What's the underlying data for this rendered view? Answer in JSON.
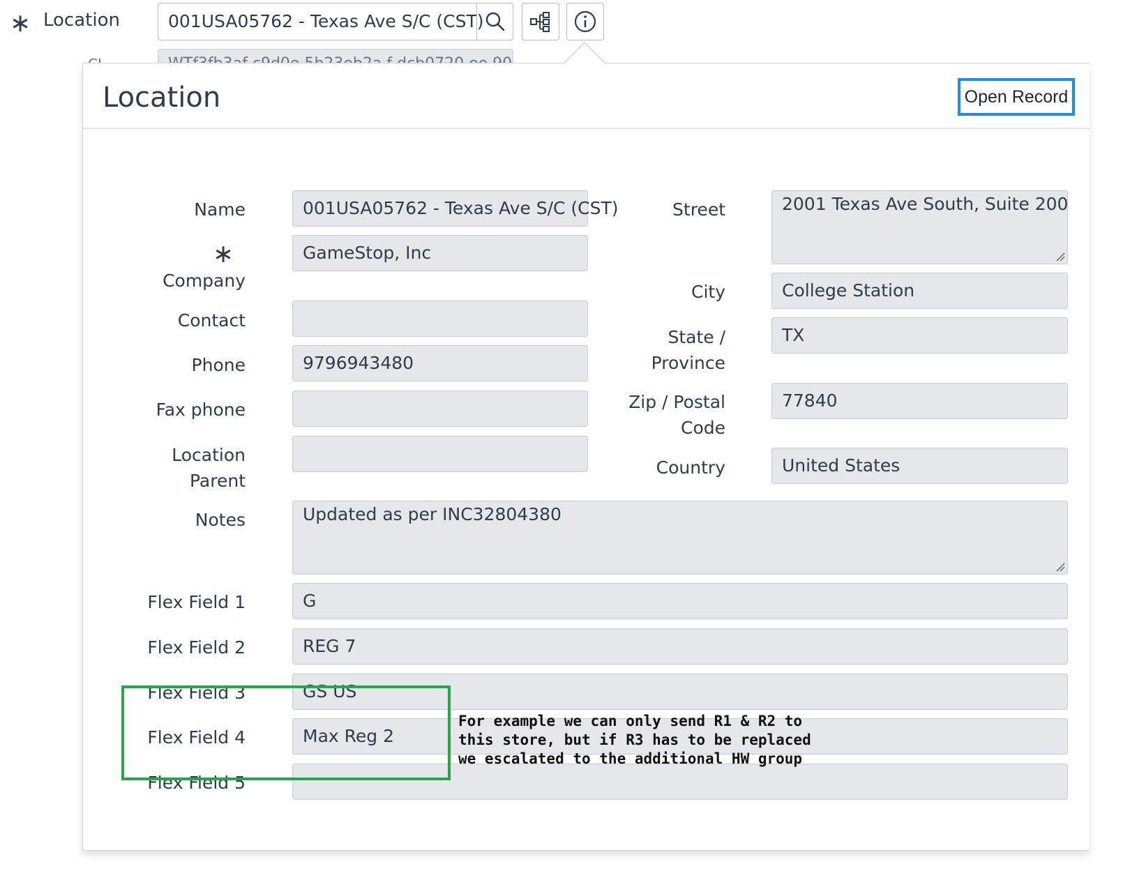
{
  "top_form": {
    "location_label": "Location",
    "location_value": "001USA05762 - Texas Ave S/C (CST)",
    "behind_label": "CI",
    "behind_value": "WTf3fb3af c9d0e 5b23eb2a f dcb0720 ee 90"
  },
  "popover": {
    "title": "Location",
    "open_record_label": "Open Record",
    "left_fields": [
      {
        "label": "Name",
        "value": "001USA05762 - Texas Ave S/C (CST)"
      },
      {
        "label": "Company",
        "value": "GameStop, Inc",
        "mandatory": true
      },
      {
        "label": "Contact",
        "value": ""
      },
      {
        "label": "Phone",
        "value": "9796943480"
      },
      {
        "label": "Fax phone",
        "value": ""
      },
      {
        "label_line1": "Location",
        "label_line2": "Parent",
        "value": ""
      }
    ],
    "right_fields": [
      {
        "label": "Street",
        "value": "2001 Texas Ave South, Suite 200"
      },
      {
        "label": "City",
        "value": "College Station"
      },
      {
        "label_line1": "State /",
        "label_line2": "Province",
        "value": "TX"
      },
      {
        "label_line1": "Zip / Postal",
        "label_line2": "Code",
        "value": "77840"
      },
      {
        "label": "Country",
        "value": "United States"
      }
    ],
    "notes": {
      "label": "Notes",
      "value": "Updated as per INC32804380"
    },
    "flex_fields": [
      {
        "label": "Flex Field 1",
        "value": "G"
      },
      {
        "label": "Flex Field 2",
        "value": "REG 7"
      },
      {
        "label": "Flex Field 3",
        "value": "GS US"
      },
      {
        "label": "Flex Field 4",
        "value": "Max Reg 2"
      },
      {
        "label": "Flex Field 5",
        "value": ""
      }
    ]
  },
  "annotation": {
    "line1": "For example we can only send R1 & R2 to",
    "line2": "this store, but if R3 has to be replaced",
    "line3": "we escalated to the additional HW group",
    "color": "#22a84a"
  },
  "colors": {
    "field_bg": "#e5e7ea",
    "accent_blue": "#1f8ceb",
    "text": "#2e3d49"
  }
}
